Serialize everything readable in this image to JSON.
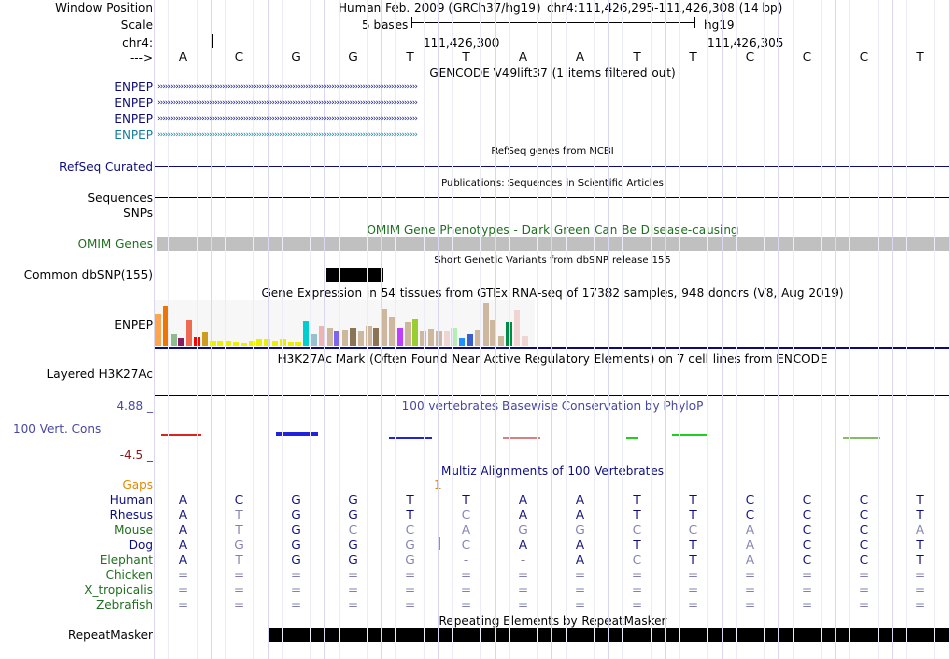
{
  "header": {
    "window_position_label": "Window Position",
    "assembly_text": "Human Feb. 2009 (GRCh37/hg19)",
    "position_text": "chr4:111,426,295-111,426,308 (14 bp)",
    "scale_label": "Scale",
    "scale_value": "5 bases",
    "scale_db": "hg19",
    "chrom_label": "chr4:",
    "coord_1": "111,426,300",
    "coord_2": "111,426,305",
    "strand_label": "--->"
  },
  "bases": [
    "A",
    "C",
    "G",
    "G",
    "T",
    "T",
    "A",
    "A",
    "T",
    "T",
    "C",
    "C",
    "C",
    "T"
  ],
  "gencode": {
    "title": "GENCODE V49lift37 (1 items filtered out)",
    "labels": [
      "ENPEP",
      "ENPEP",
      "ENPEP",
      "ENPEP"
    ],
    "arrow_glyphs": "››››››››››››››››››››››››››››››››››››››››››››››››››››››››››››››››››››››››››››››››››››››››››››››››››››",
    "colors": [
      "#0c0c78",
      "#0c0c78",
      "#0c0c78",
      "#127c9c"
    ]
  },
  "refseq": {
    "title": "RefSeq genes from NCBI",
    "label": "RefSeq Curated"
  },
  "publications": {
    "title": "Publications: Sequences in Scientific Articles",
    "label": "Sequences"
  },
  "snps": {
    "label": "SNPs"
  },
  "omim": {
    "title": "OMIM Gene Phenotypes - Dark Green Can Be Disease-causing",
    "label": "OMIM Genes"
  },
  "dbsnp": {
    "title": "Short Genetic Variants from dbSNP release 155",
    "label": "Common dbSNP(155)"
  },
  "gtex": {
    "title": "Gene Expression in 54 tissues from GTEx RNA-seq of 17382 samples, 948 donors (V8, Aug 2019)",
    "label": "ENPEP",
    "tissues": [
      {
        "level": 0.73,
        "color": "#FFA54F"
      },
      {
        "level": 0.92,
        "color": "#EE7600"
      },
      {
        "level": 0.27,
        "color": "#8FBC8F"
      },
      {
        "level": 0.19,
        "color": "#8B1C62"
      },
      {
        "level": 0.58,
        "color": "#EE6A50"
      },
      {
        "level": 0.21,
        "color": "#FF0000"
      },
      {
        "level": 0.31,
        "color": "#CD9B1D"
      },
      {
        "level": 0.12,
        "color": "#EEEE00"
      },
      {
        "level": 0.12,
        "color": "#EEEE00"
      },
      {
        "level": 0.12,
        "color": "#EEEE00"
      },
      {
        "level": 0.08,
        "color": "#EEEE00"
      },
      {
        "level": 0.06,
        "color": "#EEEE00"
      },
      {
        "level": 0.12,
        "color": "#EEEE00"
      },
      {
        "level": 0.15,
        "color": "#EEEE00"
      },
      {
        "level": 0.15,
        "color": "#EEEE00"
      },
      {
        "level": 0.12,
        "color": "#EEEE00"
      },
      {
        "level": 0.15,
        "color": "#EEEE00"
      },
      {
        "level": 0.1,
        "color": "#EEEE00"
      },
      {
        "level": 0.08,
        "color": "#EEEE00"
      },
      {
        "level": 0.56,
        "color": "#00CDCD"
      },
      {
        "level": 0.27,
        "color": "#9AC0CD"
      },
      {
        "level": 0.46,
        "color": "#EEB4B4"
      },
      {
        "level": 0.4,
        "color": "#CDB79E"
      },
      {
        "level": 0.33,
        "color": "#7A67EE"
      },
      {
        "level": 0.37,
        "color": "#CDB79E"
      },
      {
        "level": 0.4,
        "color": "#8B7355"
      },
      {
        "level": 0.35,
        "color": "#CDB79E"
      },
      {
        "level": 0.46,
        "color": "#CDB79E"
      },
      {
        "level": 0.4,
        "color": "#8B7355"
      },
      {
        "level": 0.85,
        "color": "#CDB79E"
      },
      {
        "level": 0.65,
        "color": "#CDB79E"
      },
      {
        "level": 0.42,
        "color": "#BF3EFF"
      },
      {
        "level": 0.54,
        "color": "#CDB79E"
      },
      {
        "level": 0.62,
        "color": "#9ACD32"
      },
      {
        "level": 0.35,
        "color": "#CDB79E"
      },
      {
        "level": 0.38,
        "color": "#CDB79E"
      },
      {
        "level": 0.35,
        "color": "#CDB79E"
      },
      {
        "level": 0.35,
        "color": "#EED5D2"
      },
      {
        "level": 0.42,
        "color": "#B4EEB4"
      },
      {
        "level": 0.19,
        "color": "#1E90FF"
      },
      {
        "level": 0.27,
        "color": "#3A5FCD"
      },
      {
        "level": 0.37,
        "color": "#CDB79E"
      },
      {
        "level": 0.98,
        "color": "#CDB79E"
      },
      {
        "level": 0.58,
        "color": "#CDB79E"
      },
      {
        "level": 0.23,
        "color": "#CDB79E"
      },
      {
        "level": 0.54,
        "color": "#008B45"
      },
      {
        "level": 0.81,
        "color": "#EED5D2"
      },
      {
        "level": 0.23,
        "color": "#EED5D2"
      }
    ]
  },
  "h3k27ac": {
    "title": "H3K27Ac Mark (Often Found Near Active Regulatory Elements) on 7 cell lines from ENCODE",
    "label": "Layered H3K27Ac"
  },
  "conservation": {
    "title": "100 vertebrates Basewise Conservation by PhyloP",
    "label": "100 Vert. Cons",
    "max": "4.88 _",
    "min": "-4.5 _"
  },
  "multiz": {
    "title": "Multiz Alignments of 100 Vertebrates",
    "gaps_label": "Gaps",
    "gap_marker": "1",
    "species": [
      {
        "name": "Human",
        "color": "#0c0c78",
        "bases": [
          "A",
          "C",
          "G",
          "G",
          "T",
          "T",
          "A",
          "A",
          "T",
          "T",
          "C",
          "C",
          "C",
          "T"
        ]
      },
      {
        "name": "Rhesus",
        "color": "#0c0c78",
        "bases": [
          "A",
          "T",
          "G",
          "G",
          "T",
          "C",
          "A",
          "A",
          "T",
          "T",
          "C",
          "C",
          "C",
          "T"
        ]
      },
      {
        "name": "Mouse",
        "color": "#1e6e1e",
        "bases": [
          "A",
          "T",
          "G",
          "C",
          "C",
          "A",
          "G",
          "G",
          "C",
          "C",
          "A",
          "C",
          "C",
          "A"
        ]
      },
      {
        "name": "Dog",
        "color": "#0c0c78",
        "bases": [
          "A",
          "G",
          "G",
          "G",
          "G",
          "C",
          "A",
          "A",
          "T",
          "T",
          "A",
          "C",
          "C",
          "T"
        ]
      },
      {
        "name": "Elephant",
        "color": "#1e6e1e",
        "bases": [
          "A",
          "T",
          "G",
          "G",
          "G",
          "-",
          "-",
          "A",
          "C",
          "T",
          "A",
          "C",
          "C",
          "T"
        ]
      },
      {
        "name": "Chicken",
        "color": "#1e6e1e",
        "bases": [
          "=",
          "=",
          "=",
          "=",
          "=",
          "=",
          "=",
          "=",
          "=",
          "=",
          "=",
          "=",
          "=",
          "="
        ]
      },
      {
        "name": "X_tropicalis",
        "color": "#1e6e1e",
        "bases": [
          "=",
          "=",
          "=",
          "=",
          "=",
          "=",
          "=",
          "=",
          "=",
          "=",
          "=",
          "=",
          "=",
          "="
        ]
      },
      {
        "name": "Zebrafish",
        "color": "#1e6e1e",
        "bases": [
          "=",
          "=",
          "=",
          "=",
          "=",
          "=",
          "=",
          "=",
          "=",
          "=",
          "=",
          "=",
          "=",
          "="
        ]
      }
    ]
  },
  "repeatmasker": {
    "title": "Repeating Elements by RepeatMasker",
    "label": "RepeatMasker"
  },
  "colors": {
    "label_blue": "#0c0c78",
    "omim_green": "#1e6e1e",
    "cons_blue": "#4646a0",
    "cons_red": "#8c1414",
    "gaps_orange": "#e08a00"
  }
}
